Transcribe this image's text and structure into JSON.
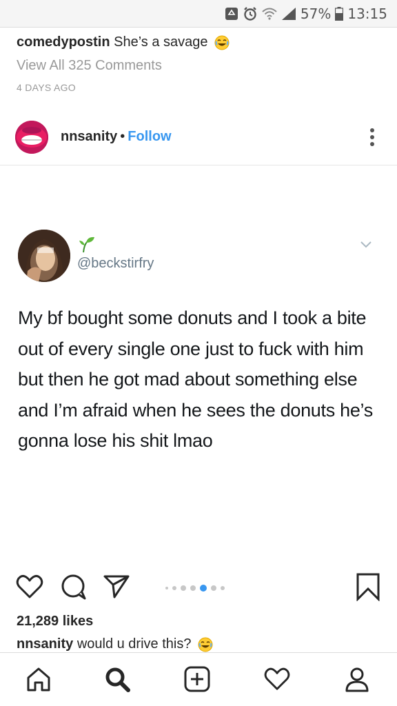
{
  "status_bar": {
    "battery_percent": "57%",
    "time": "13:15"
  },
  "previous_post": {
    "username": "comedypostin",
    "caption": "She’s a savage",
    "caption_emoji": "laughing-emoji",
    "view_comments": "View All 325 Comments",
    "timestamp": "4 DAYS AGO"
  },
  "post": {
    "username": "nnsanity",
    "separator": "•",
    "follow_label": "Follow",
    "tweet": {
      "handle": "@beckstirfry",
      "body": "My bf bought some donuts and I took a bite out of every single one just to fuck with him but then he got mad about something else and I’m afraid when he sees the donuts he’s gonna lose his shit lmao"
    },
    "carousel": {
      "total": 7,
      "active_index": 4
    },
    "likes": "21,289 likes",
    "caption_username": "nnsanity",
    "caption": "would u drive this?",
    "caption_emoji": "laughing-emoji"
  },
  "nav": {
    "items": [
      "home-icon",
      "search-icon",
      "add-post-icon",
      "activity-heart-icon",
      "profile-icon"
    ]
  },
  "colors": {
    "link_blue": "#3897f0",
    "carousel_active": "#3897f0",
    "avatar_pink": "#d81b60",
    "twitter_gray": "#657786"
  }
}
